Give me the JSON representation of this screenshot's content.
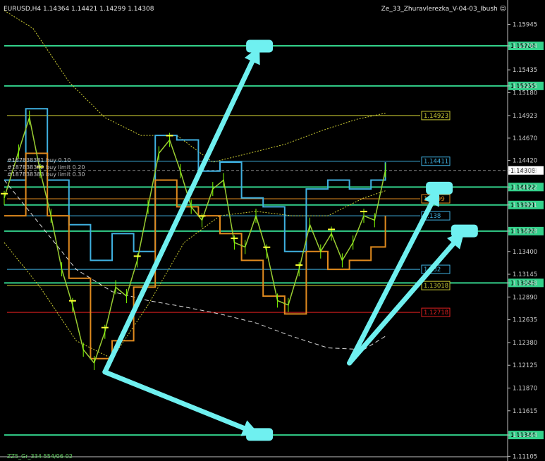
{
  "header": {
    "symbol_line": "EURUSD,H4  1.14364 1.14421 1.14299 1.14308",
    "indicator_name": "Ze_33_Zhuravlerezka_V-04-03_Ibush",
    "smiley_icon": "smiley-face-icon"
  },
  "footer": {
    "label": "ZZ5_Gr_334-554/06-02"
  },
  "orders": [
    "#187838381 buy 0.10",
    "#187838382 buy limit 0.20",
    "#187838383 buy limit 0.30"
  ],
  "colors": {
    "background": "#000000",
    "axis": "#c0c0c0",
    "level_green": "#33d18b",
    "level_yellow": "#cccc33",
    "level_orange": "#e08a1e",
    "level_red": "#e02020",
    "level_blue": "#3fb0e0",
    "price_line": "#9acd32",
    "arrow": "#6ff0f0",
    "current_price_bg": "#ffffff"
  },
  "chart_data": {
    "type": "candlestick",
    "instrument": "EURUSD",
    "timeframe": "H4",
    "ohlc": {
      "open": 1.14364,
      "high": 1.14421,
      "low": 1.14299,
      "close": 1.14308
    },
    "ylim": [
      1.111,
      1.1617
    ],
    "y_ticks": [
      "1.15945",
      "1.15704",
      "1.15435",
      "1.15255",
      "1.15180",
      "1.14923",
      "1.14670",
      "1.14420",
      "1.14308",
      "1.14122",
      "1.13921",
      "1.13628",
      "1.13400",
      "1.13145",
      "1.13048",
      "1.12890",
      "1.12635",
      "1.12380",
      "1.12125",
      "1.11870",
      "1.11615",
      "1.11344",
      "1.11105"
    ],
    "current_price": "1.14308",
    "levels": [
      {
        "value": 1.15704,
        "label": "1.15704",
        "color": "green",
        "span": "full"
      },
      {
        "value": 1.15255,
        "label": "1.15255",
        "color": "green",
        "span": "full"
      },
      {
        "value": 1.14923,
        "label": "1.14923",
        "color": "yellow",
        "span": "partial"
      },
      {
        "value": 1.14411,
        "label": "1.14411",
        "color": "blue",
        "span": "partial"
      },
      {
        "value": 1.14122,
        "label": "1.14122",
        "color": "green",
        "span": "full"
      },
      {
        "value": 1.1399,
        "label": "1.1399",
        "color": "orange",
        "span": "partial"
      },
      {
        "value": 1.13921,
        "label": "1.13921",
        "color": "green",
        "span": "full"
      },
      {
        "value": 1.138,
        "label": "1.138",
        "color": "blue",
        "span": "partial"
      },
      {
        "value": 1.13628,
        "label": "1.13628",
        "color": "green",
        "span": "full"
      },
      {
        "value": 1.132,
        "label": "1.132",
        "color": "blue",
        "span": "partial"
      },
      {
        "value": 1.13048,
        "label": "1.13048",
        "color": "green",
        "span": "full"
      },
      {
        "value": 1.13018,
        "label": "1.13018",
        "color": "yellow",
        "span": "partial"
      },
      {
        "value": 1.12718,
        "label": "1.12718",
        "color": "red",
        "span": "partial"
      },
      {
        "value": 1.11344,
        "label": "1.11344",
        "color": "green",
        "span": "full"
      }
    ],
    "price_path": [
      [
        0,
        1.14
      ],
      [
        4,
        1.1452
      ],
      [
        7,
        1.149
      ],
      [
        10,
        1.143
      ],
      [
        13,
        1.138
      ],
      [
        16,
        1.132
      ],
      [
        19,
        1.128
      ],
      [
        22,
        1.123
      ],
      [
        25,
        1.1215
      ],
      [
        28,
        1.125
      ],
      [
        31,
        1.13
      ],
      [
        34,
        1.129
      ],
      [
        37,
        1.133
      ],
      [
        40,
        1.139
      ],
      [
        43,
        1.145
      ],
      [
        46,
        1.1465
      ],
      [
        49,
        1.143
      ],
      [
        52,
        1.139
      ],
      [
        55,
        1.1375
      ],
      [
        58,
        1.141
      ],
      [
        61,
        1.142
      ],
      [
        64,
        1.135
      ],
      [
        67,
        1.1345
      ],
      [
        70,
        1.138
      ],
      [
        73,
        1.134
      ],
      [
        76,
        1.1285
      ],
      [
        79,
        1.128
      ],
      [
        82,
        1.132
      ],
      [
        85,
        1.137
      ],
      [
        88,
        1.134
      ],
      [
        91,
        1.136
      ],
      [
        94,
        1.133
      ],
      [
        97,
        1.135
      ],
      [
        100,
        1.138
      ],
      [
        103,
        1.1375
      ],
      [
        106,
        1.1431
      ]
    ],
    "upper_band": [
      [
        0,
        1.161
      ],
      [
        8,
        1.159
      ],
      [
        18,
        1.153
      ],
      [
        28,
        1.149
      ],
      [
        38,
        1.147
      ],
      [
        48,
        1.147
      ],
      [
        58,
        1.144
      ],
      [
        68,
        1.145
      ],
      [
        78,
        1.146
      ],
      [
        88,
        1.1475
      ],
      [
        98,
        1.1488
      ],
      [
        106,
        1.1495
      ]
    ],
    "lower_band": [
      [
        0,
        1.135
      ],
      [
        10,
        1.13
      ],
      [
        20,
        1.124
      ],
      [
        30,
        1.122
      ],
      [
        40,
        1.128
      ],
      [
        50,
        1.135
      ],
      [
        60,
        1.138
      ],
      [
        70,
        1.1385
      ],
      [
        80,
        1.138
      ],
      [
        90,
        1.138
      ],
      [
        100,
        1.14
      ],
      [
        106,
        1.1408
      ]
    ],
    "moving_average": [
      [
        0,
        1.142
      ],
      [
        10,
        1.137
      ],
      [
        20,
        1.132
      ],
      [
        30,
        1.1295
      ],
      [
        40,
        1.1285
      ],
      [
        50,
        1.1278
      ],
      [
        60,
        1.127
      ],
      [
        70,
        1.126
      ],
      [
        80,
        1.1245
      ],
      [
        90,
        1.1232
      ],
      [
        100,
        1.123
      ],
      [
        106,
        1.1245
      ]
    ],
    "channel_blue": [
      [
        0,
        1.142
      ],
      [
        6,
        1.15
      ],
      [
        12,
        1.142
      ],
      [
        18,
        1.137
      ],
      [
        24,
        1.133
      ],
      [
        30,
        1.136
      ],
      [
        36,
        1.134
      ],
      [
        42,
        1.147
      ],
      [
        48,
        1.1465
      ],
      [
        54,
        1.143
      ],
      [
        60,
        1.144
      ],
      [
        66,
        1.14
      ],
      [
        72,
        1.139
      ],
      [
        78,
        1.134
      ],
      [
        84,
        1.141
      ],
      [
        90,
        1.142
      ],
      [
        96,
        1.141
      ],
      [
        102,
        1.142
      ],
      [
        106,
        1.144
      ]
    ],
    "channel_orange": [
      [
        0,
        1.138
      ],
      [
        6,
        1.145
      ],
      [
        12,
        1.138
      ],
      [
        18,
        1.131
      ],
      [
        24,
        1.122
      ],
      [
        30,
        1.124
      ],
      [
        36,
        1.13
      ],
      [
        42,
        1.142
      ],
      [
        48,
        1.139
      ],
      [
        54,
        1.138
      ],
      [
        60,
        1.136
      ],
      [
        66,
        1.133
      ],
      [
        72,
        1.129
      ],
      [
        78,
        1.127
      ],
      [
        84,
        1.134
      ],
      [
        90,
        1.132
      ],
      [
        96,
        1.133
      ],
      [
        102,
        1.1345
      ],
      [
        106,
        1.138
      ]
    ],
    "arrows": [
      {
        "from": [
          28,
          1.1205
        ],
        "to": [
          71,
          1.157
        ]
      },
      {
        "from": [
          28,
          1.1205
        ],
        "to": [
          71,
          1.1135
        ]
      },
      {
        "from": [
          96,
          1.1215
        ],
        "to": [
          121,
          1.1411
        ]
      },
      {
        "from": [
          96,
          1.1215
        ],
        "to": [
          128,
          1.1363
        ]
      }
    ],
    "x_range": [
      0,
      140
    ]
  }
}
